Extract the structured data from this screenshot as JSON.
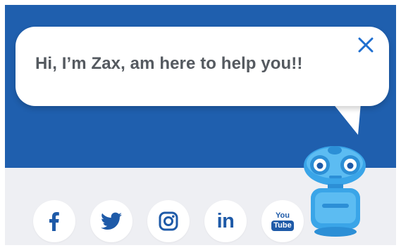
{
  "chat_popup": {
    "greeting": "Hi, I’m Zax, am here to help you!!",
    "close_icon": "close-icon"
  },
  "social_links": [
    {
      "name": "facebook",
      "icon": "facebook-icon"
    },
    {
      "name": "twitter",
      "icon": "twitter-icon"
    },
    {
      "name": "instagram",
      "icon": "instagram-icon"
    },
    {
      "name": "linkedin",
      "icon": "linkedin-icon"
    },
    {
      "name": "youtube",
      "icon": "youtube-icon"
    }
  ],
  "youtube_logo": {
    "top": "You",
    "bottom": "Tube"
  },
  "linkedin_text": "in",
  "mascot": {
    "icon": "robot-mascot-icon"
  },
  "colors": {
    "brand_blue": "#1f5fae",
    "icon_blue": "#1e5aa8",
    "text_gray": "#555a60",
    "close_blue": "#1f6fd0",
    "robot_blue": "#3aa5e8",
    "background": "#eeeff3"
  }
}
